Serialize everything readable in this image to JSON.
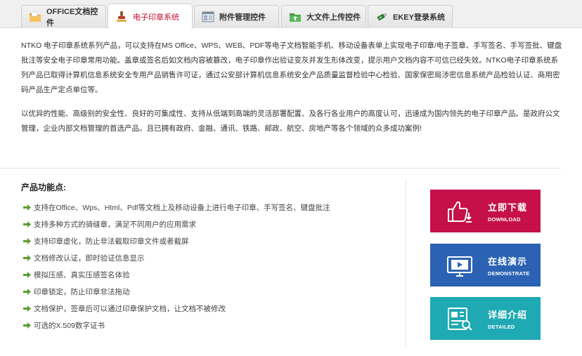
{
  "tabs": [
    {
      "label": "OFFICE文档控件",
      "icon": "folder-icon",
      "active": false
    },
    {
      "label": "电子印章系统",
      "icon": "stamp-icon",
      "active": true
    },
    {
      "label": "附件管理控件",
      "icon": "attachment-window-icon",
      "active": false
    },
    {
      "label": "大文件上传控件",
      "icon": "upload-folder-icon",
      "active": false
    },
    {
      "label": "EKEY登录系统",
      "icon": "usb-key-icon",
      "active": false
    }
  ],
  "intro": {
    "paragraph1": "NTKO 电子印章系统系列产品，可以支持在MS Office、WPS、WEB、PDF等电子文档智能手机、移动设备表单上实现电子印章/电子签章、手写签名、手写签批、键盘批注等安全电子印章常用功能。盖章或签名后如文档内容被篡改，电子印章作出验证变灰并发生形体改变，提示用户文档内容不可信已经失效。NTKO电子印章系统系列产品已取得计算机信息系统安全专用产品销售许可证，通过公安部计算机信息系统安全产品质量监督检验中心检验、国家保密局涉密信息系统产品检验认证、商用密码产品生产定点单位等。",
    "paragraph2": "以优异的性能、高级别的安全性、良好的可集成性、支持从低端到高端的灵活部署配置、及各行各业用户的高度认可，迅速成为国内领先的电子印章产品。是政府公文管理，企业内部文档管理的首选产品。且已拥有政府、金融、通讯、铁路、邮政、航空、房地产等各个领域的众多成功案例!"
  },
  "features": {
    "title": "产品功能点:",
    "items": [
      "支持在Office、Wps、Html、Pdf等文档上及移动设备上进行电子印章、手写签名、键盘批注",
      "支持多种方式的骑缝章，满足不同用户的应用需求",
      "支持印章虚化，防止非法截取印章文件或者截屏",
      "文档修改认证，即时验证信息显示",
      "模拟压感、真实压感签名体验",
      "印章锁定，防止印章非法拖动",
      "文档保护，签章后可以通过印章保护文档，让文档不被修改",
      "可选的X.509数字证书"
    ]
  },
  "actions": {
    "download": {
      "label": "立即下载",
      "sub": "DOWNLOAD",
      "icon": "thumbs-up-download-icon",
      "color": "#c5104a"
    },
    "demo": {
      "label": "在线演示",
      "sub": "DEMONSTRATE",
      "icon": "monitor-play-icon",
      "color": "#2b62b3"
    },
    "detail": {
      "label": "详细介绍",
      "sub": "DETAILED",
      "icon": "document-search-icon",
      "color": "#1ea9b3"
    }
  },
  "colors": {
    "accent_red": "#c8102e",
    "arrow_green": "#5a9e2e"
  }
}
